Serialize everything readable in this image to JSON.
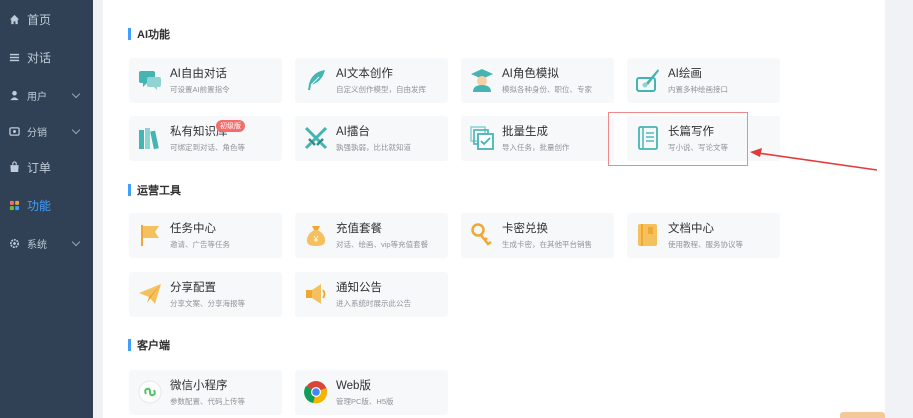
{
  "sidebar": {
    "items": [
      {
        "label": "首页",
        "icon": "home-icon"
      },
      {
        "label": "对话",
        "icon": "list-icon"
      },
      {
        "label": "用户",
        "icon": "user-icon"
      },
      {
        "label": "分销",
        "icon": "distribution-icon"
      },
      {
        "label": "订单",
        "icon": "bag-icon"
      },
      {
        "label": "功能",
        "icon": "grid-icon"
      },
      {
        "label": "系统",
        "icon": "gear-icon"
      }
    ],
    "active": "功能",
    "colors": {
      "bg": "#304156",
      "text": "#bfcbd9",
      "active": "#409eff"
    }
  },
  "sections": [
    {
      "title": "AI功能",
      "cards": [
        {
          "title": "AI自由对话",
          "desc": "可设置AI前置指令",
          "icon": "chat-icon"
        },
        {
          "title": "AI文本创作",
          "desc": "自定义创作模型，自由发挥",
          "icon": "feather-icon"
        },
        {
          "title": "AI角色模拟",
          "desc": "模拟各种身份、职位、专家",
          "icon": "graduate-icon"
        },
        {
          "title": "AI绘画",
          "desc": "内置多种绘画接口",
          "icon": "paint-icon"
        },
        {
          "title": "私有知识库",
          "desc": "可绑定到对话、角色等",
          "icon": "books-icon",
          "badge": "初级版"
        },
        {
          "title": "AI擂台",
          "desc": "孰强孰弱，比比就知道",
          "icon": "swords-icon"
        },
        {
          "title": "批量生成",
          "desc": "导入任务，批量创作",
          "icon": "batch-icon"
        },
        {
          "title": "长篇写作",
          "desc": "写小说、写论文等",
          "icon": "notebook-icon"
        }
      ]
    },
    {
      "title": "运营工具",
      "cards": [
        {
          "title": "任务中心",
          "desc": "邀请、广告等任务",
          "icon": "flag-icon"
        },
        {
          "title": "充值套餐",
          "desc": "对话、绘画、vip等充值套餐",
          "icon": "money-bag-icon"
        },
        {
          "title": "卡密兑换",
          "desc": "生成卡密，在其他平台销售",
          "icon": "key-icon"
        },
        {
          "title": "文档中心",
          "desc": "使用教程、服务协议等",
          "icon": "book-icon"
        },
        {
          "title": "分享配置",
          "desc": "分享文案、分享海报等",
          "icon": "paper-plane-icon"
        },
        {
          "title": "通知公告",
          "desc": "进入系统时展示此公告",
          "icon": "megaphone-icon"
        }
      ]
    },
    {
      "title": "客户端",
      "cards": [
        {
          "title": "微信小程序",
          "desc": "参数配置、代码上传等",
          "icon": "mini-program-icon"
        },
        {
          "title": "Web版",
          "desc": "管理PC版、H5版",
          "icon": "chrome-icon"
        }
      ]
    }
  ],
  "colors": {
    "accent": "#409eff",
    "teal": "#45b5b4",
    "orange": "#f0a830",
    "highlight": "#e23b3b"
  }
}
